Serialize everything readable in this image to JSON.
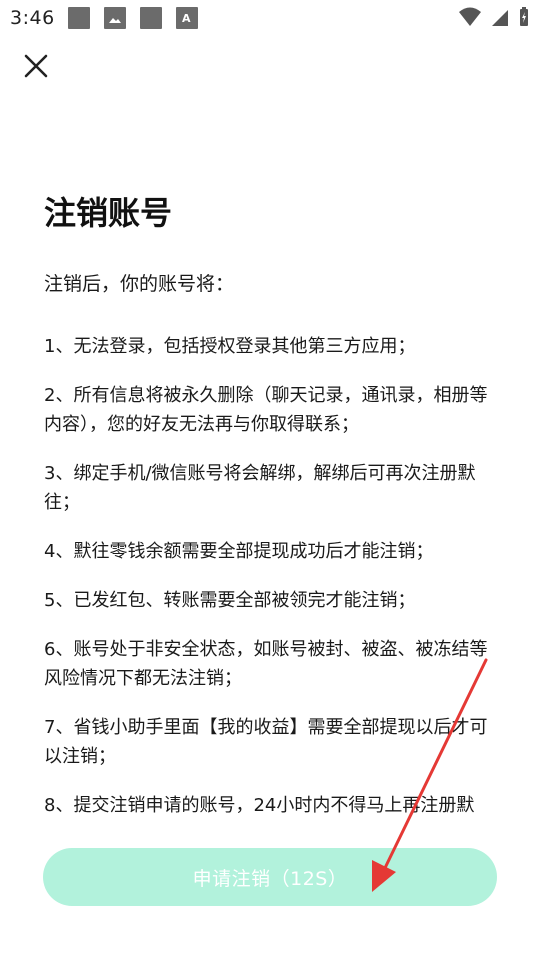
{
  "status_bar": {
    "time": "3:46",
    "left_icons": [
      "square-icon",
      "image-icon",
      "square-icon",
      "a-icon"
    ],
    "right_icons": [
      "wifi-icon",
      "signal-icon",
      "battery-icon"
    ]
  },
  "header": {
    "close_icon": "close-icon"
  },
  "page": {
    "title": "注销账号",
    "intro": "注销后，你的账号将：",
    "items": [
      "1、无法登录，包括授权登录其他第三方应用；",
      "2、所有信息将被永久删除（聊天记录，通讯录，相册等内容），您的好友无法再与你取得联系；",
      "3、绑定手机/微信账号将会解绑，解绑后可再次注册默往；",
      "4、默往零钱余额需要全部提现成功后才能注销；",
      "5、已发红包、转账需要全部被领完才能注销；",
      "6、账号处于非安全状态，如账号被封、被盗、被冻结等风险情况下都无法注销；",
      "7、省钱小助手里面【我的收益】需要全部提现以后才可以注销；",
      "8、提交注销申请的账号，24小时内不得马上再注册默"
    ]
  },
  "footer": {
    "apply_button_label": "申请注销（12S）"
  },
  "colors": {
    "button_bg": "#b2f2dc",
    "arrow": "#e53935"
  }
}
